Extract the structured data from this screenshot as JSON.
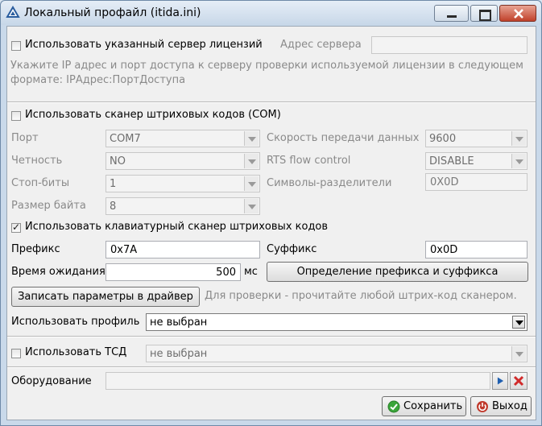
{
  "window": {
    "title": "Локальный профайл (itida.ini)"
  },
  "license": {
    "checkbox_label": "Использовать указанный сервер лицензий",
    "address_label": "Адрес сервера",
    "address_value": "",
    "hint": "Укажите IP адрес и порт доступа к серверу проверки используемой лицензии в следующем формате: IPАдрес:ПортДоступа"
  },
  "com_scanner": {
    "checkbox_label": "Использовать сканер штриховых кодов (COM)",
    "port_label": "Порт",
    "port_value": "COM7",
    "speed_label": "Скорость передачи данных",
    "speed_value": "9600",
    "parity_label": "Четность",
    "parity_value": "NO",
    "rts_label": "RTS flow control",
    "rts_value": "DISABLE",
    "stopbits_label": "Стоп-биты",
    "stopbits_value": "1",
    "separators_label": "Символы-разделители",
    "separators_value": "0X0D",
    "bytesize_label": "Размер байта",
    "bytesize_value": "8"
  },
  "kbd_scanner": {
    "checkbox_label": "Использовать клавиатурный сканер штриховых кодов",
    "checked": true,
    "prefix_label": "Префикс",
    "prefix_value": "0x7A",
    "suffix_label": "Суффикс",
    "suffix_value": "0x0D",
    "timeout_label": "Время ожидания",
    "timeout_value": "500",
    "timeout_unit": "мс",
    "detect_button": "Определение префикса и суффикса",
    "write_button": "Записать параметры в драйвер",
    "check_hint": "Для проверки - прочитайте любой штрих-код сканером."
  },
  "profile": {
    "label": "Использовать профиль",
    "value": "не выбран"
  },
  "tsd": {
    "checkbox_label": "Использовать ТСД",
    "value": "не выбран"
  },
  "equipment": {
    "label": "Оборудование",
    "value": ""
  },
  "footer": {
    "save_button": "Сохранить",
    "exit_button": "Выход"
  },
  "icons": {
    "app": "app-icon",
    "minimize": "minimize-icon",
    "maximize": "maximize-icon",
    "close": "close-icon",
    "play": "play-icon",
    "delete": "delete-x-icon",
    "save": "check-circle-icon",
    "exit": "power-icon"
  },
  "colors": {
    "close_button": "#c0412b",
    "save_icon": "#3aa53a",
    "exit_icon": "#c0392b",
    "delete_icon": "#d12a2a",
    "play_icon": "#1f5fb0"
  }
}
